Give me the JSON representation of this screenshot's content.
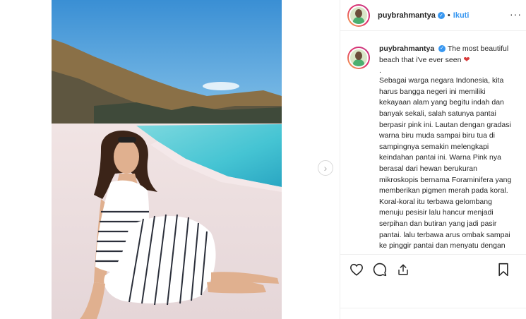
{
  "header": {
    "username": "puybrahmantya",
    "separator": "•",
    "follow_label": "Ikuti",
    "more_label": "···"
  },
  "caption": {
    "username": "puybrahmantya",
    "first_line": "The most beautiful beach that i've ever seen",
    "emoji_icon": "heart-icon",
    "dot": ".",
    "body": "Sebagai warga negara Indonesia, kita harus bangga negeri ini memiliki kekayaan alam yang begitu indah dan banyak sekali, salah satunya pantai berpasir pink ini. Lautan dengan gradasi warna biru muda sampai biru tua di sampingnya semakin melengkapi keindahan pantai ini. Warna Pink nya berasal dari hewan berukuran mikroskopis bernama Foraminifera yang memberikan pigmen merah pada koral. Koral-koral itu terbawa gelombang menuju pesisir lalu hancur menjadi serpihan dan butiran yang jadi pasir pantai. lalu terbawa arus ombak sampai ke pinggir pantai dan menyatu dengan"
  },
  "icons": {
    "verified": "verified-badge-icon",
    "like": "heart-outline-icon",
    "comment": "comment-icon",
    "share": "share-icon",
    "save": "bookmark-icon",
    "next": "chevron-right-icon"
  },
  "colors": {
    "link_blue": "#3897f0",
    "text": "#262626",
    "border": "#efefef"
  }
}
